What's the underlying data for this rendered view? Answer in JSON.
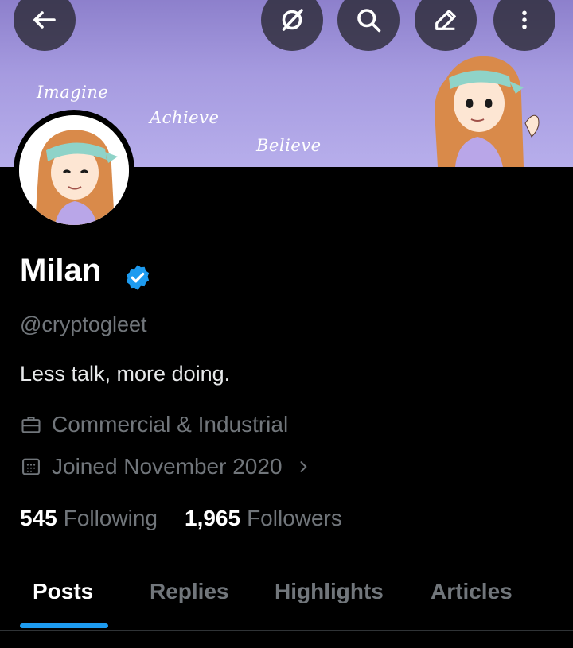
{
  "header": {
    "back_icon": "arrow-left-icon",
    "grok_icon": "grok-icon",
    "search_icon": "search-icon",
    "edit_icon": "edit-icon",
    "more_icon": "more-vertical-icon"
  },
  "banner": {
    "words": [
      "Imagine",
      "Achieve",
      "Believe"
    ]
  },
  "profile": {
    "name": "Milan",
    "handle": "@cryptogleet",
    "bio": "Less talk, more doing.",
    "category": "Commercial & Industrial",
    "joined": "Joined November 2020",
    "following_count": "545",
    "following_label": "Following",
    "followers_count": "1,965",
    "followers_label": "Followers"
  },
  "tabs": [
    "Posts",
    "Replies",
    "Highlights",
    "Articles"
  ],
  "colors": {
    "accent": "#1d9bf0",
    "muted_text": "#71767b",
    "background": "#000000"
  }
}
